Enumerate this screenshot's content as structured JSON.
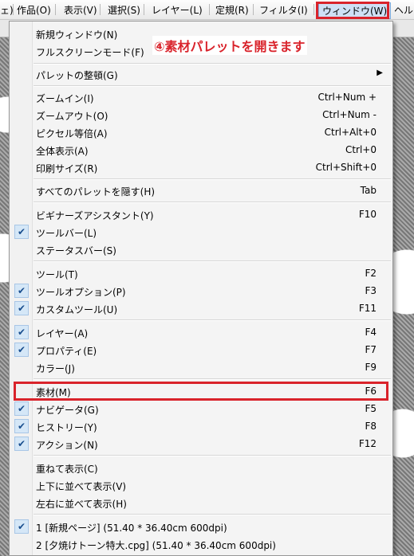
{
  "menubar": {
    "items": [
      {
        "label": "ェ)"
      },
      {
        "label": "作品(O)"
      },
      {
        "label": "表示(V)"
      },
      {
        "label": "選択(S)"
      },
      {
        "label": "レイヤー(L)"
      },
      {
        "label": "定規(R)"
      },
      {
        "label": "フィルタ(I)"
      },
      {
        "label": "ウィンドウ(W)"
      },
      {
        "label": "ヘル"
      }
    ]
  },
  "annotation": {
    "text": "④素材パレットを開きます"
  },
  "menu": {
    "items": [
      {
        "label": "新規ウィンドウ(N)",
        "shortcut": "",
        "checked": false
      },
      {
        "label": "フルスクリーンモード(F)",
        "shortcut": "",
        "checked": false
      },
      {
        "label": "パレットの整頓(G)",
        "shortcut": "",
        "checked": false,
        "submenu": true
      },
      {
        "label": "ズームイン(I)",
        "shortcut": "Ctrl+Num +",
        "checked": false
      },
      {
        "label": "ズームアウト(O)",
        "shortcut": "Ctrl+Num -",
        "checked": false
      },
      {
        "label": "ピクセル等倍(A)",
        "shortcut": "Ctrl+Alt+0",
        "checked": false
      },
      {
        "label": "全体表示(A)",
        "shortcut": "Ctrl+0",
        "checked": false
      },
      {
        "label": "印刷サイズ(R)",
        "shortcut": "Ctrl+Shift+0",
        "checked": false
      },
      {
        "label": "すべてのパレットを隠す(H)",
        "shortcut": "Tab",
        "checked": false
      },
      {
        "label": "ビギナーズアシスタント(Y)",
        "shortcut": "F10",
        "checked": false
      },
      {
        "label": "ツールバー(L)",
        "shortcut": "",
        "checked": true
      },
      {
        "label": "ステータスバー(S)",
        "shortcut": "",
        "checked": false
      },
      {
        "label": "ツール(T)",
        "shortcut": "F2",
        "checked": false
      },
      {
        "label": "ツールオプション(P)",
        "shortcut": "F3",
        "checked": true
      },
      {
        "label": "カスタムツール(U)",
        "shortcut": "F11",
        "checked": true
      },
      {
        "label": "レイヤー(A)",
        "shortcut": "F4",
        "checked": true
      },
      {
        "label": "プロパティ(E)",
        "shortcut": "F7",
        "checked": true
      },
      {
        "label": "カラー(J)",
        "shortcut": "F9",
        "checked": false
      },
      {
        "label": "素材(M)",
        "shortcut": "F6",
        "checked": false
      },
      {
        "label": "ナビゲータ(G)",
        "shortcut": "F5",
        "checked": true
      },
      {
        "label": "ヒストリー(Y)",
        "shortcut": "F8",
        "checked": true
      },
      {
        "label": "アクション(N)",
        "shortcut": "F12",
        "checked": true
      },
      {
        "label": "重ねて表示(C)",
        "shortcut": "",
        "checked": false
      },
      {
        "label": "上下に並べて表示(V)",
        "shortcut": "",
        "checked": false
      },
      {
        "label": "左右に並べて表示(H)",
        "shortcut": "",
        "checked": false
      },
      {
        "label": "1 [新規ページ] (51.40 * 36.40cm 600dpi)",
        "shortcut": "",
        "checked": true
      },
      {
        "label": "2 [夕焼けトーン特大.cpg] (51.40 * 36.40cm 600dpi)",
        "shortcut": "",
        "checked": false
      }
    ]
  }
}
